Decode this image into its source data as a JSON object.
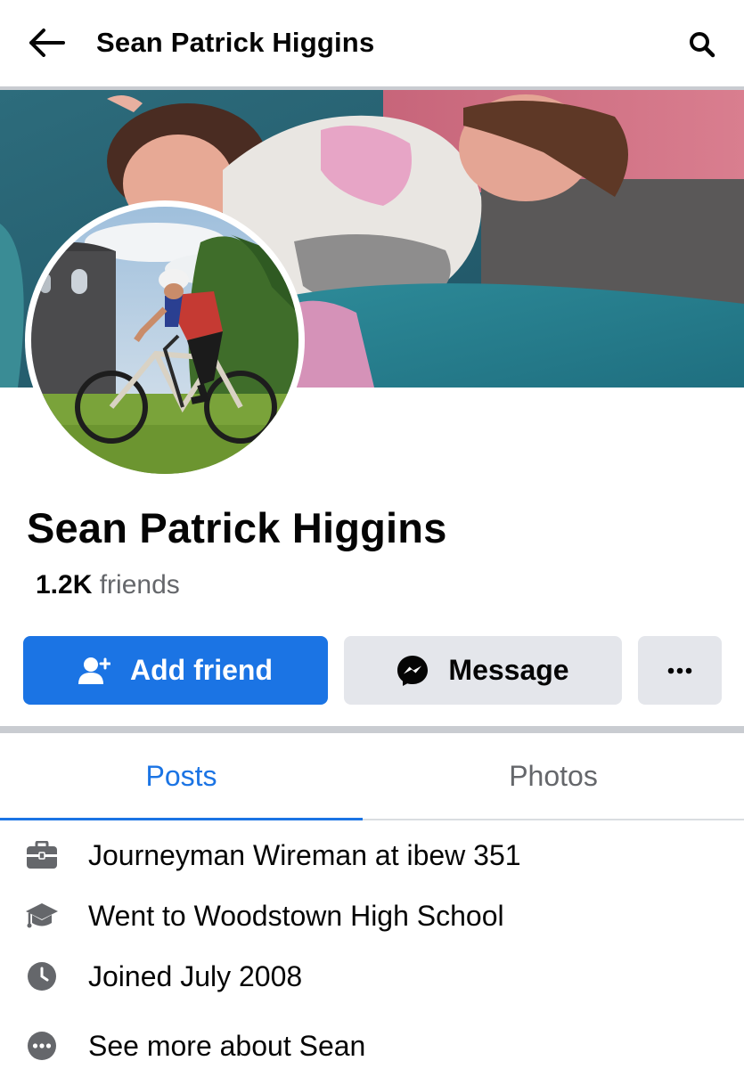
{
  "header": {
    "title": "Sean Patrick Higgins",
    "back_icon": "arrow-left-icon",
    "search_icon": "search-icon"
  },
  "profile": {
    "name": "Sean Patrick Higgins",
    "friends_count": "1.2K",
    "friends_label": "friends",
    "cover_photo": "cover-photo",
    "profile_photo": "profile-photo"
  },
  "actions": {
    "add_friend": "Add friend",
    "add_friend_icon": "add-person-icon",
    "message": "Message",
    "message_icon": "messenger-icon",
    "more": "···",
    "more_icon": "ellipsis-icon"
  },
  "tabs": [
    {
      "label": "Posts",
      "active": true
    },
    {
      "label": "Photos",
      "active": false
    }
  ],
  "intro": [
    {
      "icon": "briefcase-icon",
      "text": "Journeyman Wireman at ibew 351"
    },
    {
      "icon": "graduation-cap-icon",
      "text": "Went to Woodstown High School"
    },
    {
      "icon": "clock-icon",
      "text": "Joined July 2008"
    },
    {
      "icon": "more-dots-icon",
      "text": "See more about Sean"
    }
  ],
  "colors": {
    "accent": "#1b74e4",
    "secondary_button": "#e4e6eb",
    "muted_text": "#65676b",
    "divider": "#c9ccd1"
  }
}
